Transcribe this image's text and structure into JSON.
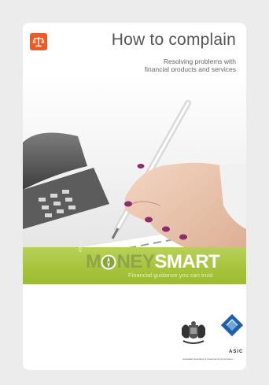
{
  "doc": {
    "title": "How to complain",
    "subtitle_line1": "Resolving problems with",
    "subtitle_line2": "financial products and services"
  },
  "brand": {
    "prefix": "ASIC's",
    "name_part1": "M",
    "name_part2": "NEY",
    "name_part3": "SMART",
    "tagline": "Financial guidance you can trust"
  },
  "footer": {
    "agency_short": "ASIC",
    "agency_full": "Australian Securities & Investments Commission"
  },
  "colors": {
    "badge": "#ec5b24",
    "banner": "#a8c43c",
    "asic_blue": "#1d5fa8"
  },
  "icons": {
    "badge": "scales-icon",
    "crest": "coat-of-arms-icon",
    "asic": "asic-diamond-icon"
  }
}
